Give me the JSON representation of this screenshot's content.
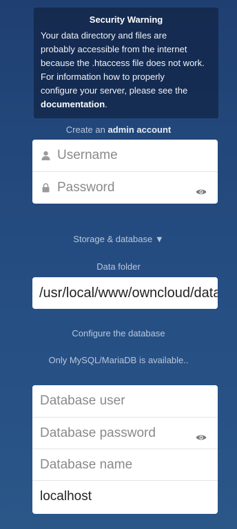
{
  "warning": {
    "title": "Security Warning",
    "lines": [
      "Your data directory and files are",
      "probably accessible from the internet",
      "because the .htaccess file does not work.",
      "For information how to properly",
      "configure your server, please see the"
    ],
    "link_text": "documentation",
    "suffix": "."
  },
  "admin": {
    "caption_prefix": "Create an",
    "caption_bold": "admin account",
    "username_placeholder": "Username",
    "password_placeholder": "Password"
  },
  "storage": {
    "toggle_label": "Storage & database ▼",
    "data_folder_label": "Data folder",
    "data_folder_value": "/usr/local/www/owncloud/data"
  },
  "database": {
    "configure_label": "Configure the database",
    "available_label": "Only MySQL/MariaDB is available..",
    "user_placeholder": "Database user",
    "password_placeholder": "Database password",
    "name_placeholder": "Database name",
    "host_value": "localhost"
  },
  "icons": {
    "user": "user-icon",
    "lock": "lock-icon",
    "eye": "eye-icon"
  }
}
